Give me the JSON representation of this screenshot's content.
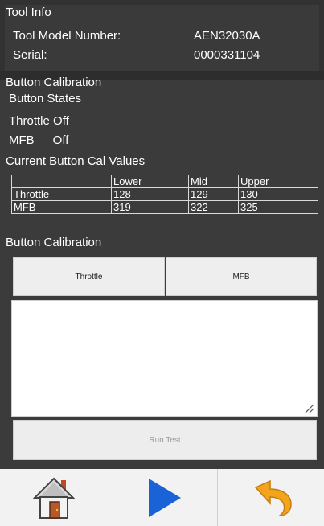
{
  "tool_info": {
    "title": "Tool Info",
    "model_label": "Tool Model Number:",
    "model_value": "AEN32030A",
    "serial_label": "Serial:",
    "serial_value": "0000331104"
  },
  "button_calibration": {
    "section_title": "Button Calibration",
    "states_title": "Button States",
    "states": [
      {
        "name": "Throttle",
        "value": "Off"
      },
      {
        "name": "MFB",
        "value": "Off"
      }
    ]
  },
  "cal_values": {
    "title": "Current Button Cal Values",
    "headers": [
      "",
      "Lower",
      "Mid",
      "Upper"
    ],
    "rows": [
      {
        "label": "Throttle",
        "lower": "128",
        "mid": "129",
        "upper": "130"
      },
      {
        "label": "MFB",
        "lower": "319",
        "mid": "322",
        "upper": "325"
      }
    ]
  },
  "calibration_actions": {
    "title": "Button Calibration",
    "throttle_button": "Throttle",
    "mfb_button": "MFB",
    "run_test_button": "Run Test"
  },
  "nav": {
    "home_icon": "home-icon",
    "play_icon": "play-icon",
    "back_icon": "undo-icon"
  }
}
